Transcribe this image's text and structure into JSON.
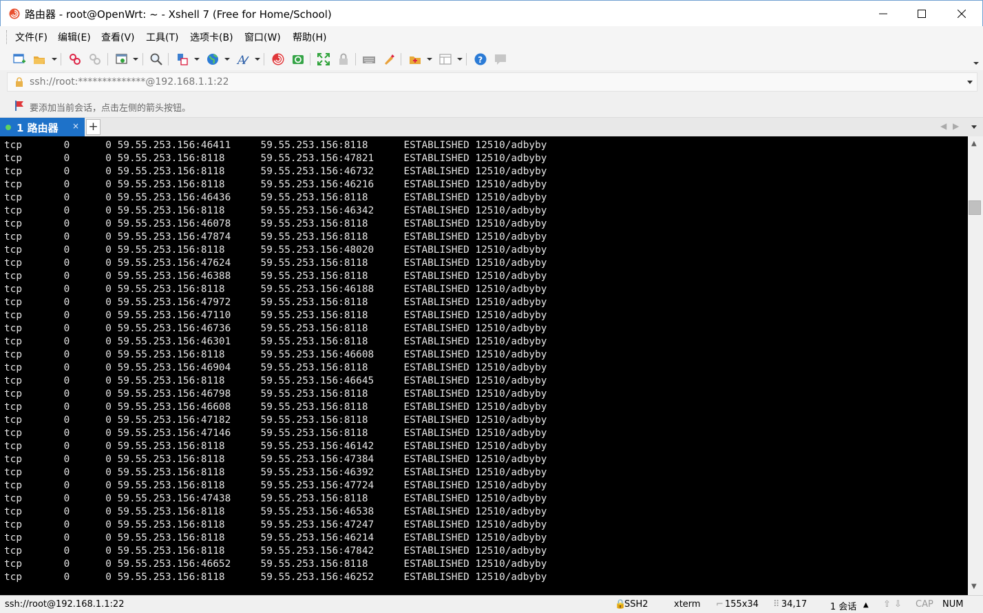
{
  "window": {
    "title": "路由器 - root@OpenWrt: ~ - Xshell 7 (Free for Home/School)"
  },
  "menu": [
    "文件(F)",
    "编辑(E)",
    "查看(V)",
    "工具(T)",
    "选项卡(B)",
    "窗口(W)",
    "帮助(H)"
  ],
  "toolbar": {
    "icons": [
      "new-session-icon",
      "open-folder-icon",
      "disconnect-icon",
      "reconnect-icon",
      "new-window-icon",
      "find-icon",
      "transfer-icon",
      "globe-icon",
      "font-icon",
      "xshell-logo-icon",
      "xftp-icon",
      "fullscreen-icon",
      "lock-icon",
      "keyboard-icon",
      "highlight-icon",
      "new-folder-icon",
      "layout-icon",
      "help-icon",
      "chat-icon"
    ]
  },
  "address": {
    "value": "ssh://root:**************@192.168.1.1:22"
  },
  "hint": {
    "text": "要添加当前会话，点击左侧的箭头按钮。"
  },
  "tabs": [
    {
      "label": "1 路由器",
      "close": "×"
    }
  ],
  "tabbar": {
    "new_tab": "+",
    "prev": "◀",
    "next": "▶"
  },
  "terminal": {
    "rows": [
      [
        "tcp",
        "0",
        "0",
        "59.55.253.156:46411",
        "59.55.253.156:8118",
        "ESTABLISHED",
        "12510/adbyby"
      ],
      [
        "tcp",
        "0",
        "0",
        "59.55.253.156:8118",
        "59.55.253.156:47821",
        "ESTABLISHED",
        "12510/adbyby"
      ],
      [
        "tcp",
        "0",
        "0",
        "59.55.253.156:8118",
        "59.55.253.156:46732",
        "ESTABLISHED",
        "12510/adbyby"
      ],
      [
        "tcp",
        "0",
        "0",
        "59.55.253.156:8118",
        "59.55.253.156:46216",
        "ESTABLISHED",
        "12510/adbyby"
      ],
      [
        "tcp",
        "0",
        "0",
        "59.55.253.156:46436",
        "59.55.253.156:8118",
        "ESTABLISHED",
        "12510/adbyby"
      ],
      [
        "tcp",
        "0",
        "0",
        "59.55.253.156:8118",
        "59.55.253.156:46342",
        "ESTABLISHED",
        "12510/adbyby"
      ],
      [
        "tcp",
        "0",
        "0",
        "59.55.253.156:46078",
        "59.55.253.156:8118",
        "ESTABLISHED",
        "12510/adbyby"
      ],
      [
        "tcp",
        "0",
        "0",
        "59.55.253.156:47874",
        "59.55.253.156:8118",
        "ESTABLISHED",
        "12510/adbyby"
      ],
      [
        "tcp",
        "0",
        "0",
        "59.55.253.156:8118",
        "59.55.253.156:48020",
        "ESTABLISHED",
        "12510/adbyby"
      ],
      [
        "tcp",
        "0",
        "0",
        "59.55.253.156:47624",
        "59.55.253.156:8118",
        "ESTABLISHED",
        "12510/adbyby"
      ],
      [
        "tcp",
        "0",
        "0",
        "59.55.253.156:46388",
        "59.55.253.156:8118",
        "ESTABLISHED",
        "12510/adbyby"
      ],
      [
        "tcp",
        "0",
        "0",
        "59.55.253.156:8118",
        "59.55.253.156:46188",
        "ESTABLISHED",
        "12510/adbyby"
      ],
      [
        "tcp",
        "0",
        "0",
        "59.55.253.156:47972",
        "59.55.253.156:8118",
        "ESTABLISHED",
        "12510/adbyby"
      ],
      [
        "tcp",
        "0",
        "0",
        "59.55.253.156:47110",
        "59.55.253.156:8118",
        "ESTABLISHED",
        "12510/adbyby"
      ],
      [
        "tcp",
        "0",
        "0",
        "59.55.253.156:46736",
        "59.55.253.156:8118",
        "ESTABLISHED",
        "12510/adbyby"
      ],
      [
        "tcp",
        "0",
        "0",
        "59.55.253.156:46301",
        "59.55.253.156:8118",
        "ESTABLISHED",
        "12510/adbyby"
      ],
      [
        "tcp",
        "0",
        "0",
        "59.55.253.156:8118",
        "59.55.253.156:46608",
        "ESTABLISHED",
        "12510/adbyby"
      ],
      [
        "tcp",
        "0",
        "0",
        "59.55.253.156:46904",
        "59.55.253.156:8118",
        "ESTABLISHED",
        "12510/adbyby"
      ],
      [
        "tcp",
        "0",
        "0",
        "59.55.253.156:8118",
        "59.55.253.156:46645",
        "ESTABLISHED",
        "12510/adbyby"
      ],
      [
        "tcp",
        "0",
        "0",
        "59.55.253.156:46798",
        "59.55.253.156:8118",
        "ESTABLISHED",
        "12510/adbyby"
      ],
      [
        "tcp",
        "0",
        "0",
        "59.55.253.156:46608",
        "59.55.253.156:8118",
        "ESTABLISHED",
        "12510/adbyby"
      ],
      [
        "tcp",
        "0",
        "0",
        "59.55.253.156:47182",
        "59.55.253.156:8118",
        "ESTABLISHED",
        "12510/adbyby"
      ],
      [
        "tcp",
        "0",
        "0",
        "59.55.253.156:47146",
        "59.55.253.156:8118",
        "ESTABLISHED",
        "12510/adbyby"
      ],
      [
        "tcp",
        "0",
        "0",
        "59.55.253.156:8118",
        "59.55.253.156:46142",
        "ESTABLISHED",
        "12510/adbyby"
      ],
      [
        "tcp",
        "0",
        "0",
        "59.55.253.156:8118",
        "59.55.253.156:47384",
        "ESTABLISHED",
        "12510/adbyby"
      ],
      [
        "tcp",
        "0",
        "0",
        "59.55.253.156:8118",
        "59.55.253.156:46392",
        "ESTABLISHED",
        "12510/adbyby"
      ],
      [
        "tcp",
        "0",
        "0",
        "59.55.253.156:8118",
        "59.55.253.156:47724",
        "ESTABLISHED",
        "12510/adbyby"
      ],
      [
        "tcp",
        "0",
        "0",
        "59.55.253.156:47438",
        "59.55.253.156:8118",
        "ESTABLISHED",
        "12510/adbyby"
      ],
      [
        "tcp",
        "0",
        "0",
        "59.55.253.156:8118",
        "59.55.253.156:46538",
        "ESTABLISHED",
        "12510/adbyby"
      ],
      [
        "tcp",
        "0",
        "0",
        "59.55.253.156:8118",
        "59.55.253.156:47247",
        "ESTABLISHED",
        "12510/adbyby"
      ],
      [
        "tcp",
        "0",
        "0",
        "59.55.253.156:8118",
        "59.55.253.156:46214",
        "ESTABLISHED",
        "12510/adbyby"
      ],
      [
        "tcp",
        "0",
        "0",
        "59.55.253.156:8118",
        "59.55.253.156:47842",
        "ESTABLISHED",
        "12510/adbyby"
      ],
      [
        "tcp",
        "0",
        "0",
        "59.55.253.156:46652",
        "59.55.253.156:8118",
        "ESTABLISHED",
        "12510/adbyby"
      ],
      [
        "tcp",
        "0",
        "0",
        "59.55.253.156:8118",
        "59.55.253.156:46252",
        "ESTABLISHED",
        "12510/adbyby"
      ]
    ]
  },
  "status": {
    "connection": "ssh://root@192.168.1.1:22",
    "protocol": "SSH2",
    "terminal_type": "xterm",
    "size": "155x34",
    "cursor": "34,17",
    "sessions": "1 会话",
    "cap": "CAP",
    "num": "NUM"
  },
  "colors": {
    "tab_active": "#1e72c9",
    "terminal_bg": "#000000",
    "terminal_fg": "#e6e6e6"
  }
}
